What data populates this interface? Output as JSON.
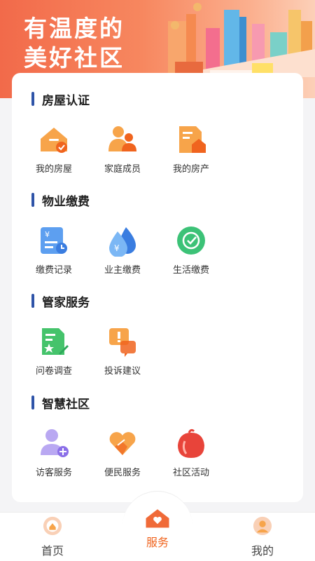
{
  "banner": {
    "line1": "有温度的",
    "line2": "美好社区"
  },
  "sections": [
    {
      "title": "房屋认证",
      "items": [
        {
          "label": "我的房屋",
          "icon": "house-check-icon"
        },
        {
          "label": "家庭成员",
          "icon": "family-icon"
        },
        {
          "label": "我的房产",
          "icon": "property-doc-icon"
        }
      ]
    },
    {
      "title": "物业缴费",
      "items": [
        {
          "label": "缴费记录",
          "icon": "payment-record-icon"
        },
        {
          "label": "业主缴费",
          "icon": "owner-payment-icon"
        },
        {
          "label": "生活缴费",
          "icon": "life-payment-icon"
        }
      ]
    },
    {
      "title": "管家服务",
      "items": [
        {
          "label": "问卷调查",
          "icon": "survey-icon"
        },
        {
          "label": "投诉建议",
          "icon": "complaint-icon"
        }
      ]
    },
    {
      "title": "智慧社区",
      "items": [
        {
          "label": "访客服务",
          "icon": "visitor-icon"
        },
        {
          "label": "便民服务",
          "icon": "convenience-icon"
        },
        {
          "label": "社区活动",
          "icon": "community-activity-icon"
        }
      ]
    }
  ],
  "nav": {
    "home": "首页",
    "service": "服务",
    "mine": "我的"
  },
  "colors": {
    "accent": "#f0641e",
    "section_bar": "#2f54a8"
  }
}
